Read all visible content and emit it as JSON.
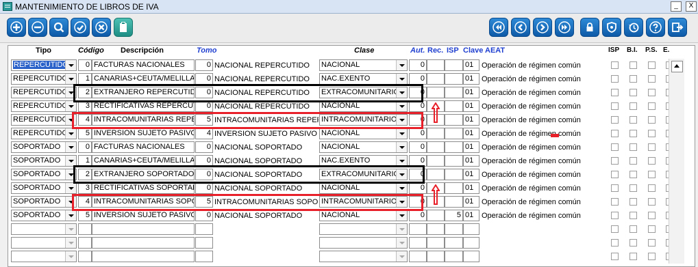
{
  "window": {
    "title": "MANTENIMIENTO DE LIBROS DE IVA",
    "min_label": "_",
    "max_label": "□",
    "close_label": "X"
  },
  "toolbar": {
    "left": [
      "add-button",
      "remove-button",
      "search-button",
      "accept-button",
      "cancel-button",
      "clipboard-button"
    ],
    "right": [
      "first-button",
      "previous-button",
      "next-button",
      "last-button",
      "lock-button",
      "shield-button",
      "history-button",
      "help-button",
      "exit-button"
    ]
  },
  "headers": {
    "tipo": "Tipo",
    "codigo": "Código",
    "descripcion": "Descripción",
    "tomo": "Tomo",
    "clase": "Clase",
    "aut": "Aut.",
    "rec": "Rec.",
    "isp": "ISP",
    "clave": "Clave AEAT",
    "isp2": "ISP",
    "bi": "B.I.",
    "ps": "P.S.",
    "e": "E."
  },
  "rows": [
    {
      "tipo": "REPERCUTIDO",
      "codigo": "0",
      "descripcion": "FACTURAS NACIONALES",
      "tomo": "0",
      "tomo_desc": "NACIONAL REPERCUTIDO",
      "clase": "NACIONAL",
      "aut": "0",
      "rec": "",
      "isp": "",
      "clave": "01",
      "clave_desc": "Operación de régimen común"
    },
    {
      "tipo": "REPERCUTIDO",
      "codigo": "1",
      "descripcion": "CANARIAS+CEUTA/MELILLA R",
      "tomo": "0",
      "tomo_desc": "NACIONAL REPERCUTIDO",
      "clase": "NAC.EXENTO",
      "aut": "0",
      "rec": "",
      "isp": "",
      "clave": "01",
      "clave_desc": "Operación de régimen común"
    },
    {
      "tipo": "REPERCUTIDO",
      "codigo": "2",
      "descripcion": "EXTRANJERO REPERCUTIDO",
      "tomo": "0",
      "tomo_desc": "NACIONAL REPERCUTIDO",
      "clase": "EXTRACOMUNITARIO",
      "aut": "0",
      "rec": "",
      "isp": "",
      "clave": "01",
      "clave_desc": "Operación de régimen común"
    },
    {
      "tipo": "REPERCUTIDO",
      "codigo": "3",
      "descripcion": "RECTIFICATIVAS REPERCUTID",
      "tomo": "0",
      "tomo_desc": "NACIONAL REPERCUTIDO",
      "clase": "NACIONAL",
      "aut": "0",
      "rec": "",
      "isp": "",
      "clave": "01",
      "clave_desc": "Operación de régimen común"
    },
    {
      "tipo": "REPERCUTIDO",
      "codigo": "4",
      "descripcion": "INTRACOMUNITARIAS REPERC",
      "tomo": "5",
      "tomo_desc": "INTRACOMUNITARIAS REPERC",
      "clase": "INTRACOMUNITARIO",
      "aut": "0",
      "rec": "",
      "isp": "",
      "clave": "01",
      "clave_desc": "Operación de régimen común"
    },
    {
      "tipo": "REPERCUTIDO",
      "codigo": "5",
      "descripcion": "INVERSION SUJETO PASIVO",
      "tomo": "4",
      "tomo_desc": "INVERSION SUJETO PASIVO RE",
      "clase": "NACIONAL",
      "aut": "0",
      "rec": "",
      "isp": "",
      "clave": "01",
      "clave_desc": "Operación de régimen común"
    },
    {
      "tipo": "SOPORTADO",
      "codigo": "0",
      "descripcion": "FACTURAS NACIONALES",
      "tomo": "0",
      "tomo_desc": "NACIONAL SOPORTADO",
      "clase": "NACIONAL",
      "aut": "0",
      "rec": "",
      "isp": "",
      "clave": "01",
      "clave_desc": "Operación de régimen común"
    },
    {
      "tipo": "SOPORTADO",
      "codigo": "1",
      "descripcion": "CANARIAS+CEUTA/MELILLA S",
      "tomo": "0",
      "tomo_desc": "NACIONAL SOPORTADO",
      "clase": "NAC.EXENTO",
      "aut": "0",
      "rec": "",
      "isp": "",
      "clave": "01",
      "clave_desc": "Operación de régimen común"
    },
    {
      "tipo": "SOPORTADO",
      "codigo": "2",
      "descripcion": "EXTRANJERO SOPORTADO",
      "tomo": "0",
      "tomo_desc": "NACIONAL SOPORTADO",
      "clase": "EXTRACOMUNITARIO",
      "aut": "0",
      "rec": "",
      "isp": "",
      "clave": "01",
      "clave_desc": "Operación de régimen común"
    },
    {
      "tipo": "SOPORTADO",
      "codigo": "3",
      "descripcion": "RECTIFICATIVAS SOPORTADO",
      "tomo": "0",
      "tomo_desc": "NACIONAL SOPORTADO",
      "clase": "NACIONAL",
      "aut": "0",
      "rec": "",
      "isp": "",
      "clave": "01",
      "clave_desc": "Operación de régimen común"
    },
    {
      "tipo": "SOPORTADO",
      "codigo": "4",
      "descripcion": "INTRACOMUNITARIAS SOPOR",
      "tomo": "5",
      "tomo_desc": "INTRACOMUNITARIAS SOPORT",
      "clase": "INTRACOMUNITARIO",
      "aut": "0",
      "rec": "",
      "isp": "",
      "clave": "01",
      "clave_desc": "Operación de régimen común"
    },
    {
      "tipo": "SOPORTADO",
      "codigo": "5",
      "descripcion": "INVERSION SUJETO PASIVO",
      "tomo": "0",
      "tomo_desc": "NACIONAL SOPORTADO",
      "clase": "NACIONAL",
      "aut": "0",
      "rec": "",
      "isp": "5",
      "clave": "01",
      "clave_desc": "Operación de régimen común"
    }
  ],
  "empty_rows": 3,
  "colors": {
    "accent": "#1f3fd0",
    "highlight_box": "#e8202a",
    "selection": "#2a62c9"
  }
}
